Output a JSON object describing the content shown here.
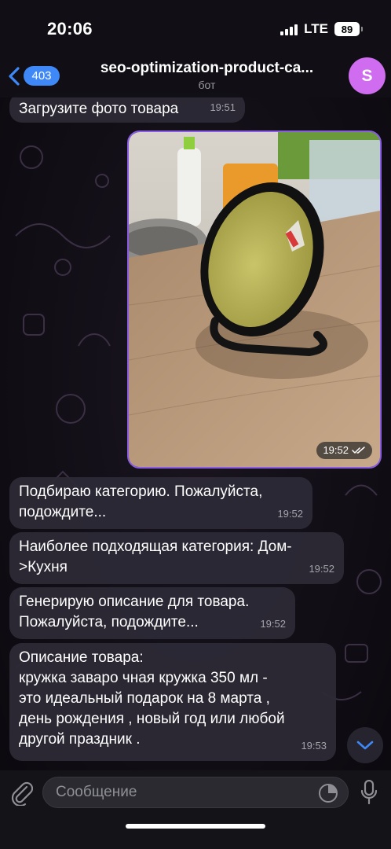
{
  "status_bar": {
    "time": "20:06",
    "network": "LTE",
    "battery": "89"
  },
  "header": {
    "back_badge": "403",
    "title": "seo-optimization-product-ca...",
    "subtitle": "бот",
    "avatar_letter": "S",
    "avatar_color": "#d06cf0",
    "accent_color": "#3e88f7"
  },
  "messages": [
    {
      "text": "Загрузите фото товара",
      "time": "19:51"
    },
    {
      "type": "photo",
      "time": "19:52",
      "status": "read"
    },
    {
      "text": "Подбираю категорию. Пожалуйста,\nподождите...",
      "time": "19:52"
    },
    {
      "text": "Наиболее подходящая категория: Дом-\n>Кухня",
      "time": "19:52"
    },
    {
      "text": "Генерирую описание для товара.\nПожалуйста, подождите...",
      "time": "19:52"
    },
    {
      "text": "Описание товара:\nкружка заваро чная кружка 350 мл -\nэто идеальный подарок на 8 марта ,\nдень рождения , новый год или любой\nдругой праздник .",
      "time": "19:53"
    }
  ],
  "composer": {
    "placeholder": "Сообщение"
  },
  "icons": {
    "back": "chevron-left-icon",
    "attach": "paperclip-icon",
    "sticker": "sticker-icon",
    "mic": "microphone-icon",
    "scroll": "chevron-down-icon",
    "read_status": "double-check-icon"
  }
}
